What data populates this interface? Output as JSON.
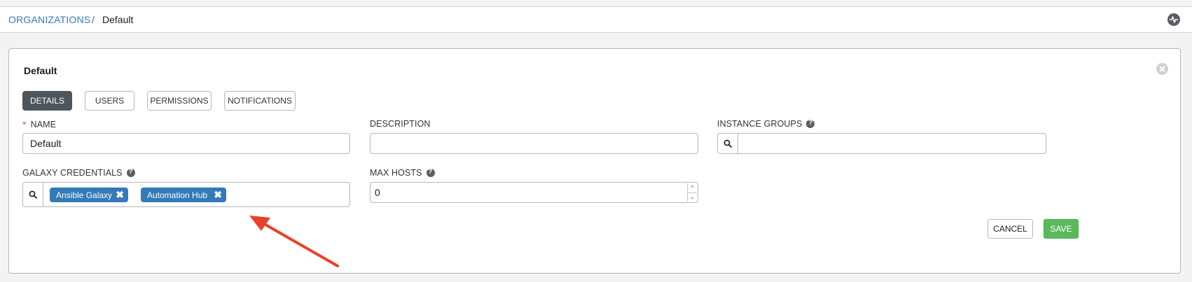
{
  "breadcrumb": {
    "parent": "ORGANIZATIONS",
    "separator": "/",
    "current": "Default"
  },
  "panel": {
    "title": "Default"
  },
  "tabs": [
    {
      "label": "DETAILS",
      "active": true
    },
    {
      "label": "USERS",
      "active": false
    },
    {
      "label": "PERMISSIONS",
      "active": false
    },
    {
      "label": "NOTIFICATIONS",
      "active": false
    }
  ],
  "fields": {
    "name": {
      "label": "NAME",
      "required_mark": "*",
      "value": "Default"
    },
    "description": {
      "label": "DESCRIPTION",
      "value": ""
    },
    "instance_groups": {
      "label": "INSTANCE GROUPS",
      "value": ""
    },
    "galaxy_credentials": {
      "label": "GALAXY CREDENTIALS",
      "chips": [
        {
          "label": "Ansible Galaxy",
          "remove": "✖"
        },
        {
          "label": "Automation Hub",
          "remove": "✖"
        }
      ]
    },
    "max_hosts": {
      "label": "MAX HOSTS",
      "value": "0",
      "up": "^",
      "down": "⌄"
    }
  },
  "actions": {
    "cancel": "CANCEL",
    "save": "SAVE"
  },
  "colors": {
    "accent": "#337ab7",
    "active_tab": "#4f555c",
    "save": "#5cb85c",
    "annotation_arrow": "#e8412c"
  },
  "icons": [
    "activity-icon",
    "close-icon",
    "search-icon",
    "help-icon",
    "remove-icon",
    "annotation-arrow"
  ]
}
